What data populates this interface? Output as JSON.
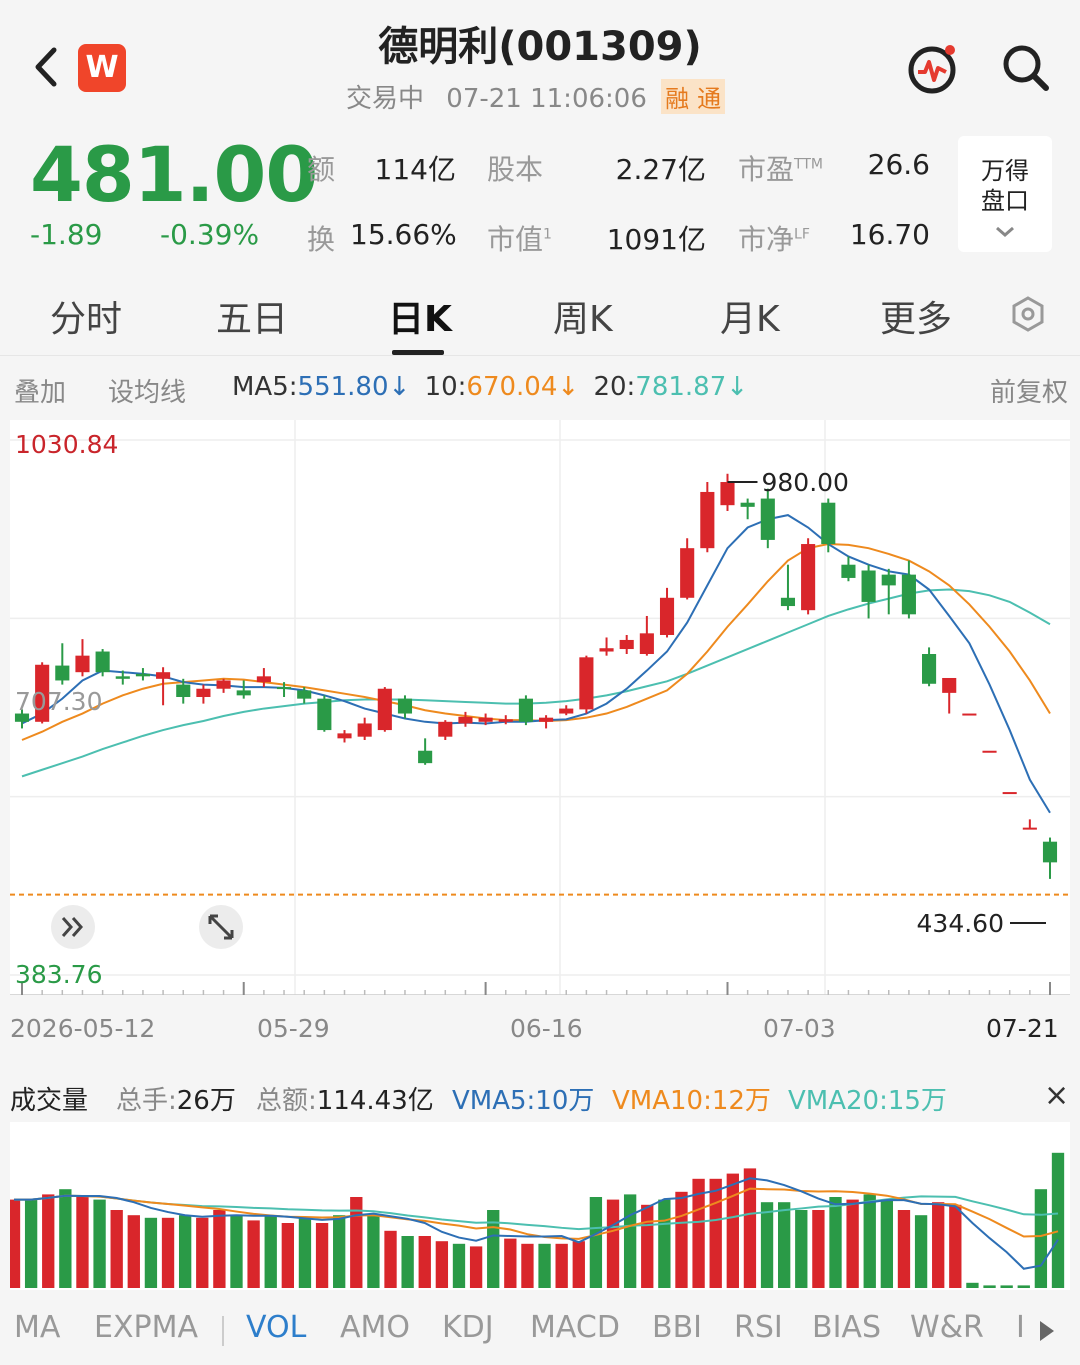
{
  "header": {
    "title": "德明利(001309)",
    "status": "交易中",
    "datetime": "07-21 11:06:06",
    "tags": [
      "融",
      "通"
    ],
    "logo_text": "W",
    "icons": [
      "back-icon",
      "app-logo-icon",
      "pulse-icon",
      "search-icon"
    ]
  },
  "quote": {
    "price": "481.00",
    "change": "-1.89",
    "change_pct": "-0.39%",
    "fields": [
      {
        "label": "额",
        "value": "114亿"
      },
      {
        "label": "股本",
        "value": "2.27亿"
      },
      {
        "label": "市盈",
        "sup": "TTM",
        "value": "26.6"
      },
      {
        "label": "换",
        "value": "15.66%"
      },
      {
        "label": "市值",
        "sup": "1",
        "value": "1091亿"
      },
      {
        "label": "市净",
        "sup": "LF",
        "value": "16.70"
      }
    ],
    "wd_button": [
      "万得",
      "盘口"
    ]
  },
  "tabs": [
    "分时",
    "五日",
    "日K",
    "周K",
    "月K",
    "更多"
  ],
  "active_tab": "日K",
  "ma_bar": {
    "overlay": "叠加",
    "set_ma": "设均线",
    "ma5_label": "MA5:",
    "ma5_value": "551.80↓",
    "ma10_label": "10:",
    "ma10_value": "670.04↓",
    "ma20_label": "20:",
    "ma20_value": "781.87↓",
    "adjust": "前复权",
    "colors": {
      "ma5": "#2d6fb5",
      "ma10": "#ee8a1e",
      "ma20": "#4cbfb0",
      "up": "#d9262b",
      "down": "#2a9a47"
    }
  },
  "chart_data": {
    "type": "candlestick",
    "y_max_label": "1030.84",
    "y_min_label": "383.76",
    "y_mid_label": "707.30",
    "high_marker": "980.00",
    "low_marker": "434.60",
    "ylim": [
      383.76,
      1030.84
    ],
    "x_ticks": [
      "2026-05-12",
      "05-29",
      "06-16",
      "07-03",
      "07-21"
    ],
    "candles": [
      {
        "o": 700,
        "c": 690,
        "h": 705,
        "l": 682
      },
      {
        "o": 690,
        "c": 759,
        "h": 762,
        "l": 688
      },
      {
        "o": 758,
        "c": 740,
        "h": 785,
        "l": 735
      },
      {
        "o": 750,
        "c": 770,
        "h": 790,
        "l": 745
      },
      {
        "o": 775,
        "c": 750,
        "h": 778,
        "l": 745
      },
      {
        "o": 745,
        "c": 742,
        "h": 752,
        "l": 735
      },
      {
        "o": 748,
        "c": 745,
        "h": 755,
        "l": 740
      },
      {
        "o": 742,
        "c": 750,
        "h": 756,
        "l": 710
      },
      {
        "o": 735,
        "c": 720,
        "h": 742,
        "l": 712
      },
      {
        "o": 720,
        "c": 730,
        "h": 735,
        "l": 712
      },
      {
        "o": 730,
        "c": 740,
        "h": 742,
        "l": 725
      },
      {
        "o": 728,
        "c": 722,
        "h": 740,
        "l": 718
      },
      {
        "o": 738,
        "c": 745,
        "h": 755,
        "l": 732
      },
      {
        "o": 732,
        "c": 731,
        "h": 738,
        "l": 720
      },
      {
        "o": 728,
        "c": 718,
        "h": 732,
        "l": 712
      },
      {
        "o": 718,
        "c": 680,
        "h": 722,
        "l": 678
      },
      {
        "o": 670,
        "c": 676,
        "h": 680,
        "l": 665
      },
      {
        "o": 672,
        "c": 688,
        "h": 695,
        "l": 668
      },
      {
        "o": 680,
        "c": 730,
        "h": 732,
        "l": 678
      },
      {
        "o": 718,
        "c": 700,
        "h": 722,
        "l": 694
      },
      {
        "o": 655,
        "c": 640,
        "h": 670,
        "l": 638
      },
      {
        "o": 672,
        "c": 690,
        "h": 692,
        "l": 668
      },
      {
        "o": 688,
        "c": 696,
        "h": 702,
        "l": 684
      },
      {
        "o": 690,
        "c": 695,
        "h": 700,
        "l": 686
      },
      {
        "o": 690,
        "c": 693,
        "h": 698,
        "l": 687
      },
      {
        "o": 718,
        "c": 690,
        "h": 722,
        "l": 686
      },
      {
        "o": 690,
        "c": 695,
        "h": 698,
        "l": 682
      },
      {
        "o": 700,
        "c": 706,
        "h": 710,
        "l": 698
      },
      {
        "o": 705,
        "c": 768,
        "h": 770,
        "l": 700
      },
      {
        "o": 775,
        "c": 779,
        "h": 792,
        "l": 770
      },
      {
        "o": 778,
        "c": 789,
        "h": 795,
        "l": 772
      },
      {
        "o": 772,
        "c": 797,
        "h": 818,
        "l": 770
      },
      {
        "o": 795,
        "c": 840,
        "h": 852,
        "l": 792
      },
      {
        "o": 840,
        "c": 900,
        "h": 912,
        "l": 838
      },
      {
        "o": 900,
        "c": 968,
        "h": 980,
        "l": 895
      },
      {
        "o": 952,
        "c": 980,
        "h": 990,
        "l": 945
      },
      {
        "o": 955,
        "c": 950,
        "h": 960,
        "l": 935
      },
      {
        "o": 960,
        "c": 910,
        "h": 972,
        "l": 900
      },
      {
        "o": 840,
        "c": 830,
        "h": 880,
        "l": 825
      },
      {
        "o": 825,
        "c": 905,
        "h": 912,
        "l": 820
      },
      {
        "o": 955,
        "c": 905,
        "h": 960,
        "l": 895
      },
      {
        "o": 880,
        "c": 864,
        "h": 890,
        "l": 860
      },
      {
        "o": 873,
        "c": 835,
        "h": 880,
        "l": 815
      },
      {
        "o": 868,
        "c": 855,
        "h": 875,
        "l": 820
      },
      {
        "o": 868,
        "c": 820,
        "h": 885,
        "l": 815
      },
      {
        "o": 772,
        "c": 736,
        "h": 780,
        "l": 733
      },
      {
        "o": 725,
        "c": 743,
        "h": 742,
        "l": 700
      },
      {
        "o": 700,
        "c": 700,
        "h": 700,
        "l": 700
      },
      {
        "o": 655,
        "c": 655,
        "h": 655,
        "l": 655
      },
      {
        "o": 605,
        "c": 605,
        "h": 605,
        "l": 605
      },
      {
        "o": 562,
        "c": 562,
        "h": 572,
        "l": 560
      },
      {
        "o": 545,
        "c": 520,
        "h": 550,
        "l": 500
      }
    ],
    "ma5": [
      688,
      700,
      718,
      740,
      752,
      750,
      748,
      745,
      738,
      735,
      734,
      732,
      732,
      731,
      728,
      722,
      715,
      706,
      700,
      694,
      690,
      688,
      689,
      688,
      690,
      690,
      692,
      693,
      700,
      712,
      730,
      752,
      775,
      810,
      855,
      900,
      925,
      935,
      940,
      925,
      905,
      890,
      880,
      872,
      868,
      850,
      818,
      785,
      735,
      680,
      620,
      580
    ],
    "ma10": [
      668,
      678,
      690,
      700,
      712,
      722,
      730,
      736,
      738,
      740,
      742,
      741,
      738,
      735,
      732,
      728,
      724,
      720,
      715,
      710,
      704,
      700,
      697,
      694,
      692,
      692,
      691,
      692,
      695,
      700,
      708,
      718,
      728,
      748,
      775,
      805,
      832,
      860,
      885,
      900,
      905,
      904,
      900,
      893,
      885,
      872,
      855,
      832,
      805,
      775,
      740,
      700
    ],
    "ma20": [
      624,
      632,
      640,
      648,
      657,
      665,
      673,
      680,
      686,
      691,
      697,
      702,
      706,
      709,
      712,
      714,
      716,
      717,
      717,
      717,
      716,
      715,
      714,
      713,
      712,
      712,
      713,
      715,
      718,
      722,
      727,
      733,
      739,
      748,
      758,
      768,
      778,
      788,
      798,
      808,
      818,
      826,
      833,
      839,
      845,
      849,
      850,
      848,
      843,
      835,
      822,
      808
    ],
    "x_tick_index": [
      0,
      11,
      23,
      35,
      51
    ]
  },
  "volume": {
    "title": "成交量",
    "total_hand_label": "总手:",
    "total_hand": "26万",
    "total_amt_label": "总额:",
    "total_amt": "114.43亿",
    "vma5": "VMA5:10万",
    "vma10": "VMA10:12万",
    "vma20": "VMA20:15万",
    "close": "×",
    "bars": [
      34,
      34,
      36,
      38,
      35,
      34,
      30,
      28,
      27,
      27,
      28,
      27,
      30,
      28,
      26,
      28,
      25,
      27,
      25,
      28,
      35,
      28,
      22,
      20,
      20,
      18,
      17,
      16,
      30,
      19,
      17,
      17,
      17,
      18,
      35,
      34,
      36,
      32,
      34,
      37,
      42,
      42,
      44,
      46,
      33,
      33,
      30,
      30,
      35,
      34,
      36,
      34,
      30,
      28,
      33,
      32,
      2,
      1,
      1,
      1,
      38,
      52
    ]
  },
  "indicators": [
    "MA",
    "EXPMA",
    "VOL",
    "AMO",
    "KDJ",
    "MACD",
    "BBI",
    "RSI",
    "BIAS",
    "W&R",
    "I"
  ],
  "active_indicator": "VOL"
}
